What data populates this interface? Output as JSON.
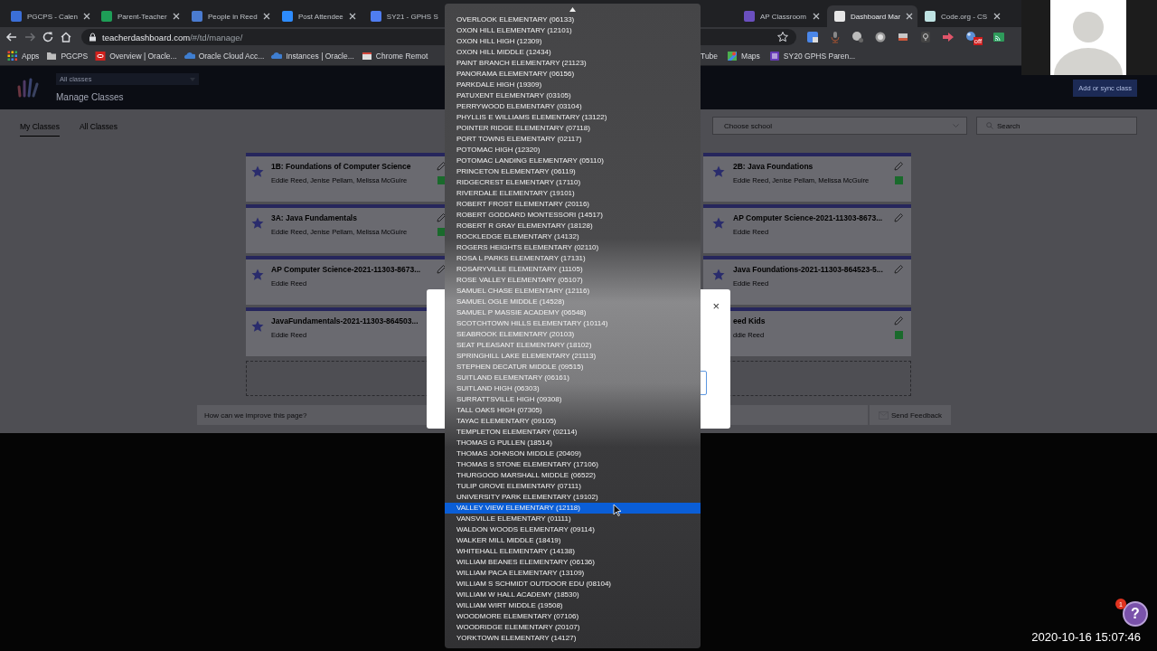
{
  "browser": {
    "tabs": {
      "left": [
        {
          "title": "PGCPS - Calen",
          "color": "#3b6fd8",
          "selected": false
        },
        {
          "title": "Parent-Teacher",
          "color": "#1e9e57",
          "selected": false
        },
        {
          "title": "People in Reed",
          "color": "#4a7bd0",
          "selected": false
        },
        {
          "title": "Post Attendee",
          "color": "#2d8cff",
          "selected": false
        },
        {
          "title": "SY21 - GPHS S",
          "color": "#4f7df0",
          "selected": false
        }
      ],
      "right": [
        {
          "title": "AP Classroom",
          "color": "#6a4fbf",
          "selected": false
        },
        {
          "title": "Dashboard Mar",
          "color": "#e8e8e8",
          "selected": true
        },
        {
          "title": "Code.org - CS",
          "color": "#bfe3e3",
          "selected": false
        }
      ]
    },
    "address": {
      "host": "teacherdashboard.com",
      "path": "/#/td/manage/"
    },
    "extension_badge": "off",
    "bookmarks": {
      "left": [
        {
          "label": "Apps",
          "kind": "apps"
        },
        {
          "label": "PGCPS",
          "kind": "folder"
        },
        {
          "label": "Overview | Oracle...",
          "kind": "oracle"
        },
        {
          "label": "Oracle Cloud Acc...",
          "kind": "cloud"
        },
        {
          "label": "Instances | Oracle...",
          "kind": "cloud"
        },
        {
          "label": "Chrome Remot",
          "kind": "page"
        }
      ],
      "right": [
        {
          "label": "Tube",
          "kind": "none"
        },
        {
          "label": "Maps",
          "kind": "maps"
        },
        {
          "label": "SY20 GPHS Paren...",
          "kind": "form"
        }
      ]
    }
  },
  "header": {
    "class_filter": "All classes",
    "title": "Manage Classes",
    "add_button": "Add or sync class"
  },
  "view_tabs": [
    {
      "label": "My Classes",
      "selected": true
    },
    {
      "label": "All Classes",
      "selected": false
    }
  ],
  "school_select": {
    "placeholder": "Choose school"
  },
  "search": {
    "placeholder": "Search"
  },
  "card_columns": {
    "first": [
      {
        "title": "1B: Foundations of Computer Science",
        "teachers": "Eddie Reed, Jenise Pellam, Melissa McGuire",
        "linked": true,
        "star": true,
        "edit": true
      },
      {
        "title": "3A: Java Fundamentals",
        "teachers": "Eddie Reed, Jenise Pellam, Melissa McGuire",
        "linked": true,
        "star": true,
        "edit": true
      },
      {
        "title": "AP Computer Science-2021-11303-8673...",
        "teachers": "Eddie Reed",
        "linked": false,
        "star": true,
        "edit": true
      },
      {
        "title": "JavaFundamentals-2021-11303-864503...",
        "teachers": "Eddie Reed",
        "linked": false,
        "star": true,
        "edit": false
      }
    ],
    "last": [
      {
        "title": "2B: Java Foundations",
        "teachers": "Eddie Reed, Jenise Pellam, Melissa McGuire",
        "linked": true,
        "star": true,
        "edit": true
      },
      {
        "title": "AP Computer Science-2021-11303-8673...",
        "teachers": "Eddie Reed",
        "linked": false,
        "star": true,
        "edit": true
      },
      {
        "title": "Java Foundations-2021-11303-864523-5...",
        "teachers": "Eddie Reed",
        "linked": false,
        "star": true,
        "edit": true
      },
      {
        "title": "eed Kids",
        "teachers": "ddie Reed",
        "linked": true,
        "star": false,
        "edit": true
      }
    ]
  },
  "feedback": {
    "placeholder": "How can we improve this page?",
    "send_button": "Send Feedback"
  },
  "modal": {
    "close": "×"
  },
  "school_menu": {
    "options": [
      {
        "label": "OVERLOOK ELEMENTARY (06133)",
        "selected": false
      },
      {
        "label": "OXON HILL ELEMENTARY (12101)",
        "selected": false
      },
      {
        "label": "OXON HILL HIGH (12309)",
        "selected": false
      },
      {
        "label": "OXON HILL MIDDLE (12434)",
        "selected": false
      },
      {
        "label": "PAINT BRANCH ELEMENTARY (21123)",
        "selected": false
      },
      {
        "label": "PANORAMA ELEMENTARY (06156)",
        "selected": false
      },
      {
        "label": "PARKDALE HIGH (19309)",
        "selected": false
      },
      {
        "label": "PATUXENT ELEMENTARY (03105)",
        "selected": false
      },
      {
        "label": "PERRYWOOD ELEMENTARY (03104)",
        "selected": false
      },
      {
        "label": "PHYLLIS E WILLIAMS ELEMENTARY (13122)",
        "selected": false
      },
      {
        "label": "POINTER RIDGE ELEMENTARY (07118)",
        "selected": false
      },
      {
        "label": "PORT TOWNS ELEMENTARY (02117)",
        "selected": false
      },
      {
        "label": "POTOMAC HIGH (12320)",
        "selected": false
      },
      {
        "label": "POTOMAC LANDING ELEMENTARY (05110)",
        "selected": false
      },
      {
        "label": "PRINCETON ELEMENTARY (06119)",
        "selected": false
      },
      {
        "label": "RIDGECREST ELEMENTARY (17110)",
        "selected": false
      },
      {
        "label": "RIVERDALE ELEMENTARY (19101)",
        "selected": false
      },
      {
        "label": "ROBERT FROST ELEMENTARY (20116)",
        "selected": false
      },
      {
        "label": "ROBERT GODDARD MONTESSORI (14517)",
        "selected": false
      },
      {
        "label": "ROBERT R GRAY ELEMENTARY (18128)",
        "selected": false
      },
      {
        "label": "ROCKLEDGE ELEMENTARY (14132)",
        "selected": false
      },
      {
        "label": "ROGERS HEIGHTS ELEMENTARY (02110)",
        "selected": false
      },
      {
        "label": "ROSA L PARKS ELEMENTARY (17131)",
        "selected": false
      },
      {
        "label": "ROSARYVILLE ELEMENTARY (11105)",
        "selected": false
      },
      {
        "label": "ROSE VALLEY ELEMENTARY (05107)",
        "selected": false
      },
      {
        "label": "SAMUEL CHASE ELEMENTARY (12116)",
        "selected": false
      },
      {
        "label": "SAMUEL OGLE MIDDLE (14528)",
        "selected": false
      },
      {
        "label": "SAMUEL P MASSIE ACADEMY (06548)",
        "selected": false
      },
      {
        "label": "SCOTCHTOWN HILLS ELEMENTARY (10114)",
        "selected": false
      },
      {
        "label": "SEABROOK ELEMENTARY (20103)",
        "selected": false
      },
      {
        "label": "SEAT PLEASANT ELEMENTARY (18102)",
        "selected": false
      },
      {
        "label": "SPRINGHILL LAKE ELEMENTARY (21113)",
        "selected": false
      },
      {
        "label": "STEPHEN DECATUR MIDDLE (09515)",
        "selected": false
      },
      {
        "label": "SUITLAND ELEMENTARY (06161)",
        "selected": false
      },
      {
        "label": "SUITLAND HIGH (06303)",
        "selected": false
      },
      {
        "label": "SURRATTSVILLE HIGH (09308)",
        "selected": false
      },
      {
        "label": "TALL OAKS HIGH (07305)",
        "selected": false
      },
      {
        "label": "TAYAC ELEMENTARY (09105)",
        "selected": false
      },
      {
        "label": "TEMPLETON ELEMENTARY (02114)",
        "selected": false
      },
      {
        "label": "THOMAS G PULLEN (18514)",
        "selected": false
      },
      {
        "label": "THOMAS JOHNSON MIDDLE (20409)",
        "selected": false
      },
      {
        "label": "THOMAS S STONE ELEMENTARY (17106)",
        "selected": false
      },
      {
        "label": "THURGOOD MARSHALL MIDDLE (06522)",
        "selected": false
      },
      {
        "label": "TULIP GROVE ELEMENTARY (07111)",
        "selected": false
      },
      {
        "label": "UNIVERSITY PARK ELEMENTARY (19102)",
        "selected": false
      },
      {
        "label": "VALLEY VIEW ELEMENTARY (12118)",
        "selected": true
      },
      {
        "label": "VANSVILLE ELEMENTARY (01111)",
        "selected": false
      },
      {
        "label": "WALDON WOODS ELEMENTARY (09114)",
        "selected": false
      },
      {
        "label": "WALKER MILL MIDDLE (18419)",
        "selected": false
      },
      {
        "label": "WHITEHALL ELEMENTARY (14138)",
        "selected": false
      },
      {
        "label": "WILLIAM BEANES ELEMENTARY (06136)",
        "selected": false
      },
      {
        "label": "WILLIAM PACA ELEMENTARY (13109)",
        "selected": false
      },
      {
        "label": "WILLIAM S SCHMIDT OUTDOOR EDU (08104)",
        "selected": false
      },
      {
        "label": "WILLIAM W HALL ACADEMY (18530)",
        "selected": false
      },
      {
        "label": "WILLIAM WIRT MIDDLE (19508)",
        "selected": false
      },
      {
        "label": "WOODMORE ELEMENTARY (07106)",
        "selected": false
      },
      {
        "label": "WOODRIDGE ELEMENTARY (20107)",
        "selected": false
      },
      {
        "label": "YORKTOWN ELEMENTARY (14127)",
        "selected": false
      }
    ]
  },
  "recording": {
    "timestamp": "2020-10-16 15:07:46",
    "help": "?",
    "help_badge": "1"
  }
}
